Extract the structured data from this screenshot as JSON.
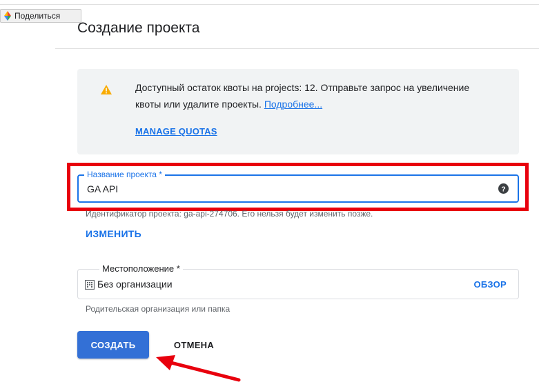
{
  "share": {
    "label": "Поделиться",
    "icon": "share-logo-icon"
  },
  "page": {
    "title": "Создание проекта"
  },
  "quota": {
    "icon": "warning-icon",
    "icon_color": "#f9ab00",
    "text": "Доступный остаток квоты на projects: 12. Отправьте запрос на увеличение квоты или удалите проекты.",
    "learn_more": "Подробнее...",
    "manage_label": "MANAGE QUOTAS"
  },
  "project_name": {
    "label": "Название проекта *",
    "value": "GA API",
    "help_icon": "help-icon",
    "id_text": "Идентификатор проекта: ga-api-274706. Его нельзя будет изменить позже.",
    "change_label": "ИЗМЕНИТЬ"
  },
  "location": {
    "label": "Местоположение *",
    "value": "Без организации",
    "icon": "building-icon",
    "browse_label": "ОБЗОР",
    "hint": "Родительская организация или папка"
  },
  "actions": {
    "create_label": "СОЗДАТЬ",
    "cancel_label": "ОТМЕНА"
  },
  "annotation": {
    "highlight_color": "#e8000d",
    "arrow_color": "#e8000d"
  },
  "colors": {
    "accent": "#1a73e8",
    "primary_button": "#3370d6"
  }
}
